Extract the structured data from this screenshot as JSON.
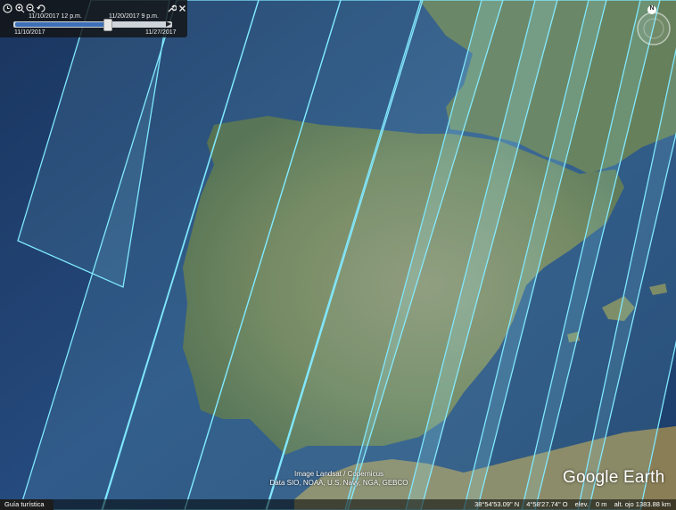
{
  "time_slider": {
    "start_label": "11/10/2017  12 p.m.",
    "end_label": "11/20/2017  9 p.m.",
    "range_start": "11/10/2017",
    "range_end": "11/27/2017",
    "position_fraction": 0.59
  },
  "compass": {
    "north_label": "N"
  },
  "attribution": {
    "line1": "Image Landsat / Copernicus",
    "line2": "Data SIO, NOAA, U.S. Navy, NGA, GEBCO"
  },
  "logo": {
    "text": "Google Earth"
  },
  "status_bar": {
    "tour_guide": "Guía turística",
    "latitude": "38°54'53.09\" N",
    "longitude": "4°58'27.74\" O",
    "elevation_label": "elev.",
    "elevation_value": "0 m",
    "eye_alt": "alt. ojo  1383.88 km"
  },
  "colors": {
    "swath_outline": "#7fe8ff",
    "swath_fill": "#9ff6ff",
    "ocean": "#1e3f6e",
    "land": "#6f7a4a"
  },
  "icons": [
    "clock-icon",
    "zoom-in-icon",
    "zoom-out-icon",
    "loop-icon",
    "wrench-icon",
    "close-icon",
    "compass-icon"
  ]
}
